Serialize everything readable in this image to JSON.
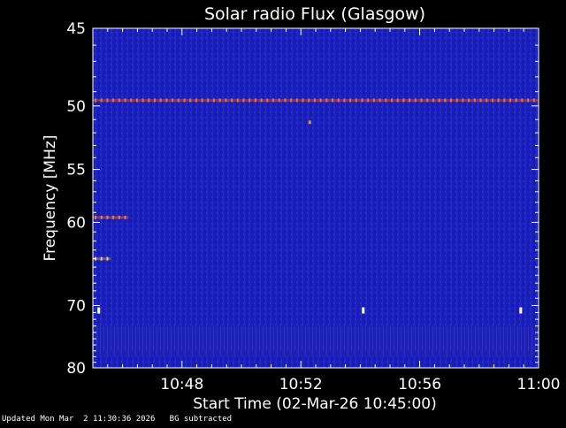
{
  "chart_data": {
    "type": "heatmap",
    "title": "Solar radio Flux (Glasgow)",
    "xlabel": "Start Time (02-Mar-26 10:45:00)",
    "ylabel": "Frequency [MHz]",
    "x_range_minutes": [
      0,
      15
    ],
    "x_ticks": [
      {
        "label": "10:48",
        "minute": 3
      },
      {
        "label": "10:52",
        "minute": 7
      },
      {
        "label": "10:56",
        "minute": 11
      },
      {
        "label": "11:00",
        "minute": 15
      }
    ],
    "y_range_mhz": [
      45,
      80
    ],
    "y_scale": "reciprocal",
    "y_ticks": [
      45,
      50,
      55,
      60,
      70,
      80
    ],
    "background_color": "#1a1fb8",
    "emission_lines": [
      {
        "frequency_mhz": 49.6,
        "minute_start": 0,
        "minute_end": 15,
        "color": "#ff6a2a"
      },
      {
        "frequency_mhz": 59.5,
        "minute_start": 0,
        "minute_end": 1.2,
        "color": "#ff7a2a"
      },
      {
        "frequency_mhz": 64.0,
        "minute_start": 0,
        "minute_end": 0.6,
        "color": "#ffcc33"
      }
    ],
    "spots": [
      {
        "frequency_mhz": 51.2,
        "minute": 7.3,
        "color": "#ff8800"
      },
      {
        "frequency_mhz": 70.7,
        "minute": 0.2,
        "color": "#ffffff"
      },
      {
        "frequency_mhz": 70.7,
        "minute": 9.1,
        "color": "#ffffff"
      },
      {
        "frequency_mhz": 70.7,
        "minute": 14.4,
        "color": "#ffffff"
      }
    ],
    "noise_band_mhz": [
      73,
      78
    ]
  },
  "footer": {
    "text": "Updated Mon Mar  2 11:30:36 2026   BG subtracted"
  }
}
